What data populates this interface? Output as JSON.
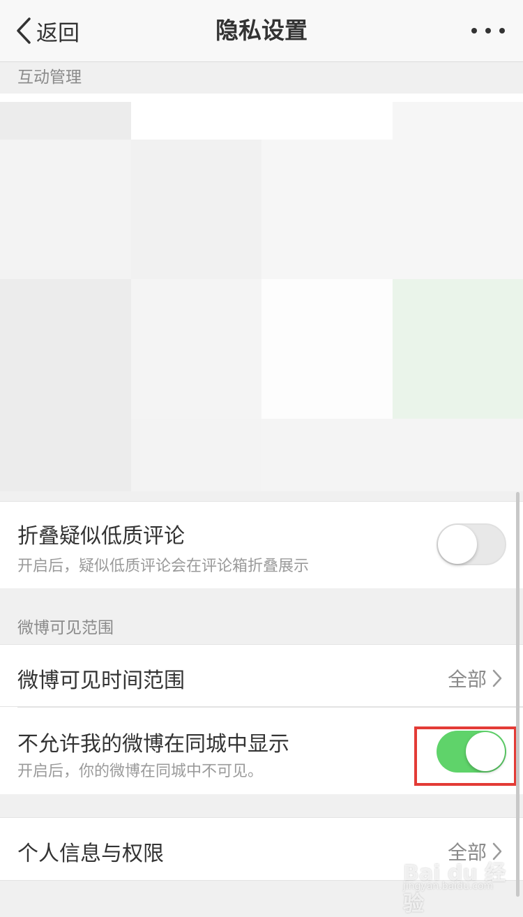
{
  "nav": {
    "back_label": "返回",
    "title": "隐私设置"
  },
  "sections": {
    "interaction": "互动管理",
    "weibo_visibility": "微博可见范围"
  },
  "mosaic_colors": [
    "#ececec",
    "#ffffff",
    "#ffffff",
    "#f6f6f6",
    "#f3f3f3",
    "#f1f1f1",
    "#f6f6f6",
    "#f6f6f6",
    "#ececec",
    "#f4f4f4",
    "#fdfdfd",
    "#eaf4ea",
    "#ececec",
    "#f3f3f3",
    "#f4f4f4",
    "#f4f4f4"
  ],
  "rows": {
    "fold_comments": {
      "title": "折叠疑似低质评论",
      "subtitle": "开启后，疑似低质评论会在评论箱折叠展示",
      "enabled": false
    },
    "visible_time_range": {
      "title": "微博可见时间范围",
      "value": "全部"
    },
    "hide_in_city": {
      "title": "不允许我的微博在同城中显示",
      "subtitle": "开启后，你的微博在同城中不可见。",
      "enabled": true
    },
    "personal_info": {
      "title": "个人信息与权限",
      "value": "全部"
    }
  },
  "watermark": {
    "brand": "Bai du 经验",
    "url": "jingyan.baidu.com"
  },
  "colors": {
    "switch_on": "#5fd36a",
    "highlight": "#e33b36"
  }
}
